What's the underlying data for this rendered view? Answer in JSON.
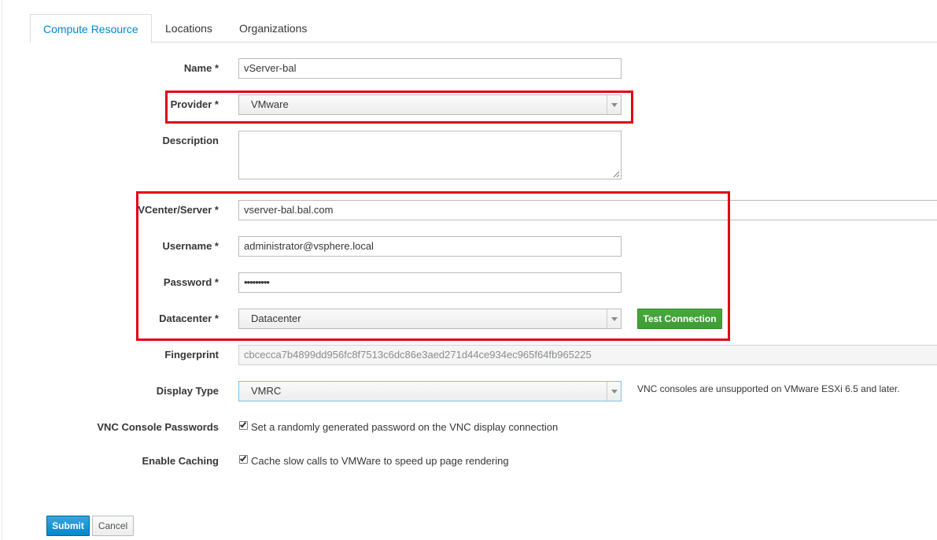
{
  "tabs": [
    {
      "label": "Compute Resource",
      "active": true
    },
    {
      "label": "Locations",
      "active": false
    },
    {
      "label": "Organizations",
      "active": false
    }
  ],
  "form": {
    "name": {
      "label": "Name *",
      "value": "vServer-bal"
    },
    "provider": {
      "label": "Provider *",
      "value": "VMware"
    },
    "description": {
      "label": "Description",
      "value": ""
    },
    "vcenter": {
      "label": "VCenter/Server *",
      "value": "vserver-bal.bal.com"
    },
    "username": {
      "label": "Username *",
      "value": "administrator@vsphere.local"
    },
    "password": {
      "label": "Password *",
      "value": "•••••••••"
    },
    "datacenter": {
      "label": "Datacenter *",
      "value": "Datacenter"
    },
    "test_connection": {
      "label": "Test Connection"
    },
    "fingerprint": {
      "label": "Fingerprint",
      "value": "cbcecca7b4899dd956fc8f7513c6dc86e3aed271d44ce934ec965f64fb965225"
    },
    "display_type": {
      "label": "Display Type",
      "value": "VMRC",
      "help": "VNC consoles are unsupported on VMware ESXi 6.5 and later."
    },
    "vnc_passwords": {
      "label": "VNC Console Passwords",
      "text": "Set a randomly generated password on the VNC display connection",
      "checked": true
    },
    "caching": {
      "label": "Enable Caching",
      "text": "Cache slow calls to VMWare to speed up page rendering",
      "checked": true
    }
  },
  "actions": {
    "submit": "Submit",
    "cancel": "Cancel"
  },
  "colors": {
    "highlight": "#e2001a",
    "primary": "#0088ce",
    "success": "#3f9c35"
  }
}
